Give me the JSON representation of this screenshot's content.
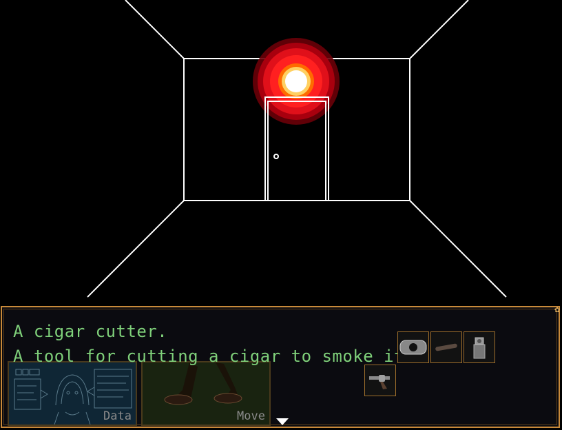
{
  "dialog": {
    "line1": "A cigar cutter.",
    "line2": "A tool for cutting a cigar to smoke it."
  },
  "menu": {
    "data_label": "Data",
    "move_label": "Move"
  },
  "inventory": {
    "items": [
      "cigar-cutter-icon",
      "cigar-icon",
      "lighter-icon",
      "revolver-icon"
    ]
  },
  "colors": {
    "dialog_text": "#7fd07a",
    "frame": "#c98a3a",
    "light_outer": "#b00010",
    "light_mid": "#ff1e1e",
    "light_core": "#ffd060"
  }
}
